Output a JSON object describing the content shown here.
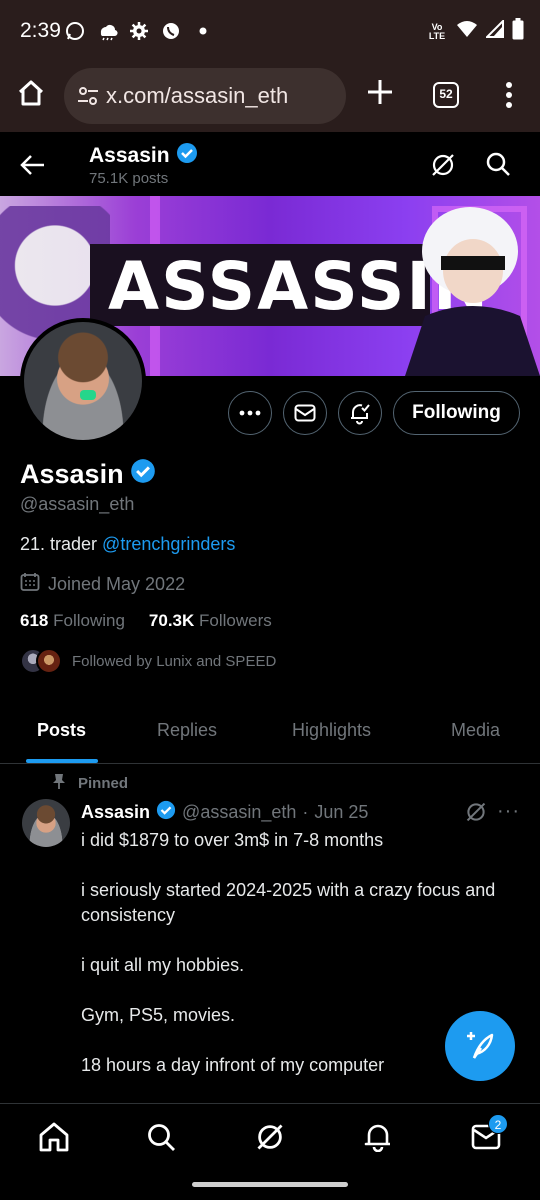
{
  "status_bar": {
    "time": "2:39",
    "network": "Vo LTE"
  },
  "browser": {
    "url": "x.com/assasin_eth",
    "tab_count": "52"
  },
  "header": {
    "name": "Assasin",
    "posts_count": "75.1K posts"
  },
  "banner": {
    "text": "ASSASSIN"
  },
  "actions": {
    "following_label": "Following"
  },
  "profile": {
    "name": "Assasin",
    "handle": "@assasin_eth",
    "bio_text": "21. trader ",
    "bio_link": "@trenchgrinders",
    "joined": "Joined May 2022",
    "following_count": "618",
    "following_label": "Following",
    "followers_count": "70.3K",
    "followers_label": "Followers",
    "followed_by": "Followed by Lunix and SPEED"
  },
  "tabs": [
    {
      "label": "Posts",
      "active": true
    },
    {
      "label": "Replies",
      "active": false
    },
    {
      "label": "Highlights",
      "active": false
    },
    {
      "label": "Media",
      "active": false
    }
  ],
  "tweet": {
    "pinned_label": "Pinned",
    "author": "Assasin",
    "handle": "@assasin_eth",
    "date": "Jun 25",
    "more": "···",
    "lines": [
      "i did $1879 to over 3m$ in 7-8 months",
      "i seriously started 2024-2025 with a crazy focus and consistency",
      "i quit all my hobbies.",
      "Gym, PS5,  movies.",
      "18 hours a day infront of my computer"
    ]
  },
  "bottom_nav": {
    "messages_badge": "2"
  },
  "colors": {
    "accent": "#1d9bf0",
    "background": "#000000",
    "muted": "#71767b",
    "chrome": "#2a1d1c"
  }
}
